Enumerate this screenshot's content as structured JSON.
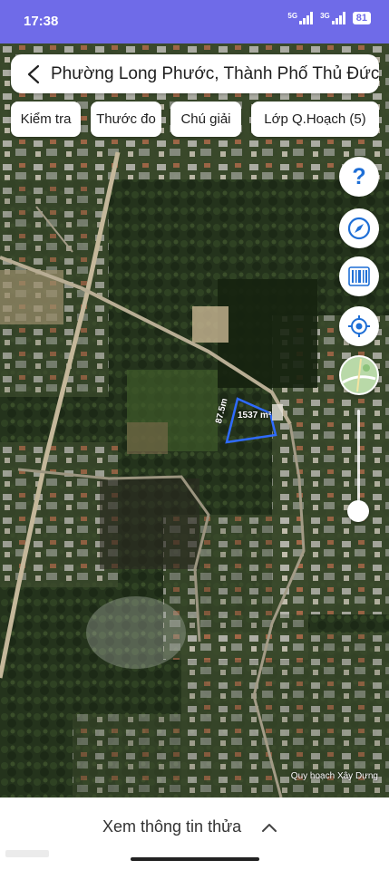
{
  "status_bar": {
    "time": "17:38",
    "signal_1": "5G",
    "signal_2": "3G",
    "battery": "81"
  },
  "header": {
    "title": "Phường Long Phước, Thành Phố Thủ Đức"
  },
  "toolbar": {
    "check_label": "Kiểm tra",
    "measure_label": "Thước đo",
    "legend_label": "Chú giải",
    "layer_label": "Lớp Q.Hoạch (5)"
  },
  "map": {
    "plot_area": "1537 m²",
    "plot_length": "87.5m",
    "credit": "Quy hoạch Xây Dựng",
    "plot_outline_color": "#2f6bff",
    "zoom_level": 0.1
  },
  "side_controls": [
    "help-icon",
    "compass-icon",
    "barcode-icon",
    "locate-icon",
    "map-type-icon"
  ],
  "bottom_sheet": {
    "label": "Xem thông tin thửa"
  }
}
